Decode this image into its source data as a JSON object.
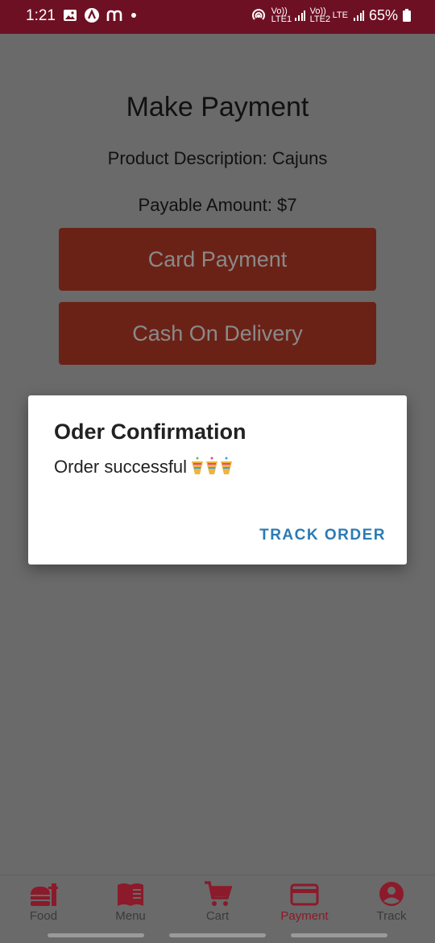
{
  "status_bar": {
    "time": "1:21",
    "battery": "65%",
    "network_1": "Vo)) LTE1",
    "network_2": "Vo)) LTE2",
    "network_3": "LTE"
  },
  "page": {
    "title": "Make Payment",
    "product_description": "Product Description: Cajuns",
    "payable_amount": "Payable Amount: $7",
    "card_payment_label": "Card Payment",
    "cod_label": "Cash On Delivery"
  },
  "dialog": {
    "title": "Oder Confirmation",
    "message": "Order successful",
    "action_label": "TRACK ORDER"
  },
  "bottom_nav": {
    "items": [
      {
        "label": "Food",
        "icon": "food-icon"
      },
      {
        "label": "Menu",
        "icon": "menu-book-icon"
      },
      {
        "label": "Cart",
        "icon": "cart-icon"
      },
      {
        "label": "Payment",
        "icon": "payment-card-icon"
      },
      {
        "label": "Track",
        "icon": "account-icon"
      }
    ],
    "active": "Payment"
  },
  "colors": {
    "status_bar": "#6e1024",
    "accent": "#8b1a2a",
    "button": "#6b2216",
    "dialog_action": "#2a7bb5",
    "overlay": "#6a6a6a"
  }
}
